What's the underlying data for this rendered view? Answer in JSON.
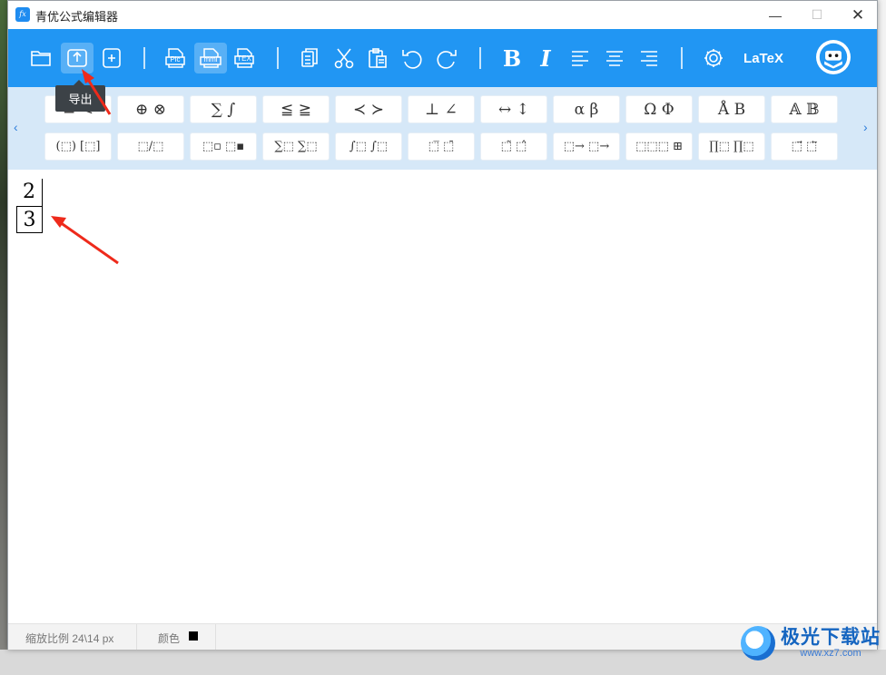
{
  "window": {
    "title": "青优公式编辑器",
    "app_icon_text": "fx",
    "minimize_glyph": "—",
    "maximize_glyph": "☐",
    "close_glyph": "✕"
  },
  "toolbar": {
    "tooltip": "导出",
    "bold_label": "B",
    "italic_label": "I",
    "latex_label": "LaTeX",
    "accent_color": "#2196f3",
    "pic_label": "Pic",
    "mml_label": "mml",
    "tex_label": "TEX"
  },
  "palette": {
    "row1": [
      "≡ <",
      "⊕ ⊗",
      "∑ ∫",
      "≦ ≧",
      "≺ ≻",
      "⊥ ∠",
      "↔ ↕",
      "α β",
      "Ω Φ",
      "Å B",
      "𝔸 𝔹"
    ],
    "row2": [
      "(⬚) [⬚]",
      "⬚/⬚",
      "⬚▫ ⬚▪",
      "∑⬚ ∑⬚",
      "∫⬚ ∫⬚",
      "⬚̅ ⬚̄",
      "⬚̃ ⬚̂",
      "⬚→ ⬚→",
      "⬚⬚⬚ ⊞",
      "∏⬚ ∏⬚",
      "⬚⃗ ⬚⃖"
    ],
    "left_arrow": "‹",
    "right_arrow": "›"
  },
  "editor": {
    "fraction": {
      "numerator": "2",
      "denominator": "3"
    }
  },
  "status": {
    "zoom": "缩放比例 24\\14 px",
    "color_label": "颜色",
    "color_value": "#000000"
  },
  "watermark": {
    "title": "极光下载站",
    "url": "www.xz7.com"
  }
}
